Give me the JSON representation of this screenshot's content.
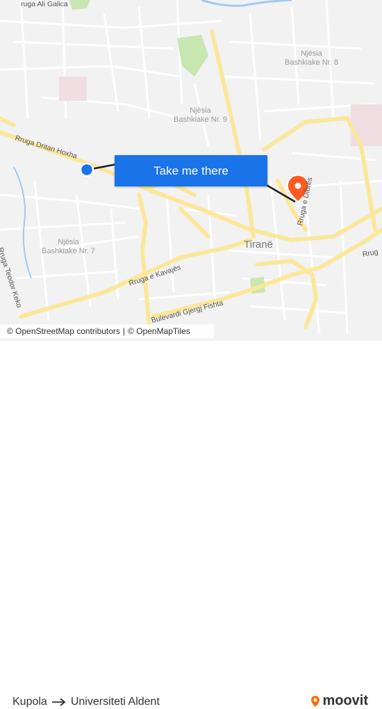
{
  "map": {
    "labels": {
      "top_left_road": "ruga Ali Galica",
      "district_8": "Njësia\nBashkiake Nr. 8",
      "district_9": "Njësia\nBashkiake Nr. 9",
      "district_7": "Njësia\nBashkiake Nr. 7",
      "city": "Tiranë",
      "road_dritan": "Rruga Dritan Hoxha",
      "road_kavajes": "Rruga e Kavajës",
      "road_fishta": "Bulevardi Gjergj Fishta",
      "road_teodor": "Rruga Teodor Keko",
      "road_dibres": "Rruga e Dibrës",
      "road_right": "Rrug"
    },
    "colors": {
      "background": "#f2f2f2",
      "major_road": "#fbe79a",
      "minor_road": "#ffffff",
      "park": "#c8e6b0",
      "water": "#a3c8f0",
      "route_line": "#1f1f1f",
      "origin": "#1a73e8",
      "destination": "#ff5a1f"
    },
    "markers": {
      "origin_icon": "origin-circle-icon",
      "destination_icon": "destination-pin-icon"
    }
  },
  "cta": {
    "label": "Take me there"
  },
  "attribution": {
    "osm_contributors": "© OpenStreetMap contributors",
    "separator": "|",
    "openmaptiles": "© OpenMapTiles"
  },
  "route": {
    "from": "Kupola",
    "to": "Universiteti Aldent"
  },
  "brand": {
    "logo_text": "moovit",
    "logo_color": "#ff6a00"
  }
}
